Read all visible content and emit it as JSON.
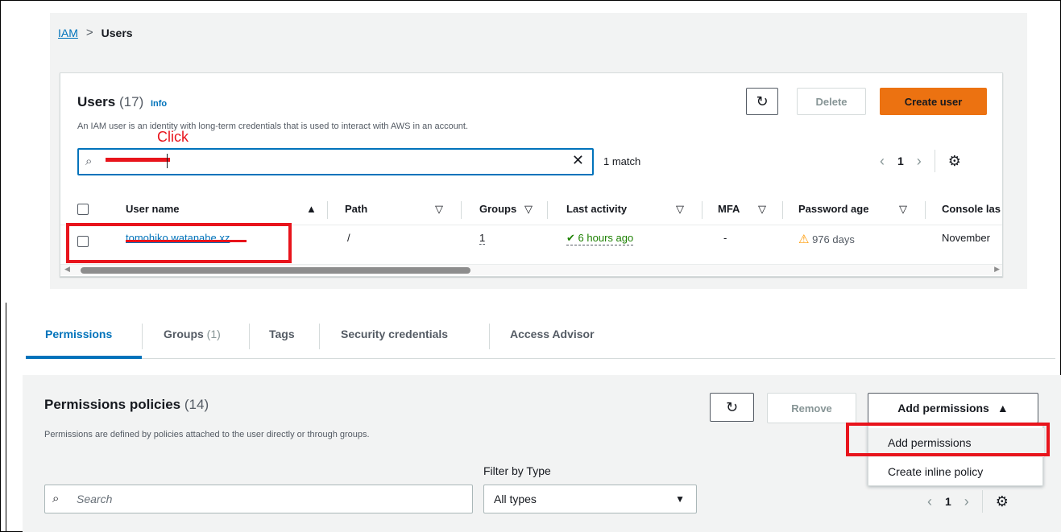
{
  "breadcrumb": {
    "root": "IAM",
    "separator": ">",
    "current": "Users"
  },
  "users": {
    "title": "Users",
    "count": "(17)",
    "info": "Info",
    "description": "An IAM user is an identity with long-term credentials that is used to interact with AWS in an account.",
    "refresh_icon": "refresh-icon",
    "delete_label": "Delete",
    "create_label": "Create user",
    "search_value": "",
    "match_text": "1 match",
    "page": "1",
    "columns": [
      "User name",
      "Path",
      "Groups",
      "Last activity",
      "MFA",
      "Password age",
      "Console las"
    ],
    "row": {
      "user_name": "tomohiko.watanabe.xz",
      "path": "/",
      "groups": "1",
      "last_activity": "6 hours ago",
      "mfa": "-",
      "password_age": "976 days",
      "console_last": "November"
    },
    "click_annotation": "Click"
  },
  "tabs": [
    {
      "label": "Permissions",
      "count": ""
    },
    {
      "label": "Groups",
      "count": "(1)"
    },
    {
      "label": "Tags",
      "count": ""
    },
    {
      "label": "Security credentials",
      "count": ""
    },
    {
      "label": "Access Advisor",
      "count": ""
    }
  ],
  "permissions": {
    "title": "Permissions policies",
    "count": "(14)",
    "description": "Permissions are defined by policies attached to the user directly or through groups.",
    "remove_label": "Remove",
    "add_label": "Add permissions",
    "menu": [
      "Add permissions",
      "Create inline policy"
    ],
    "filter_label": "Filter by Type",
    "search_placeholder": "Search",
    "type_value": "All types",
    "page": "1"
  },
  "colors": {
    "accent": "#0073bb",
    "primary_button": "#ec7211",
    "annotation_red": "#e8141c",
    "success": "#1d8102",
    "warning": "#ff9900"
  }
}
